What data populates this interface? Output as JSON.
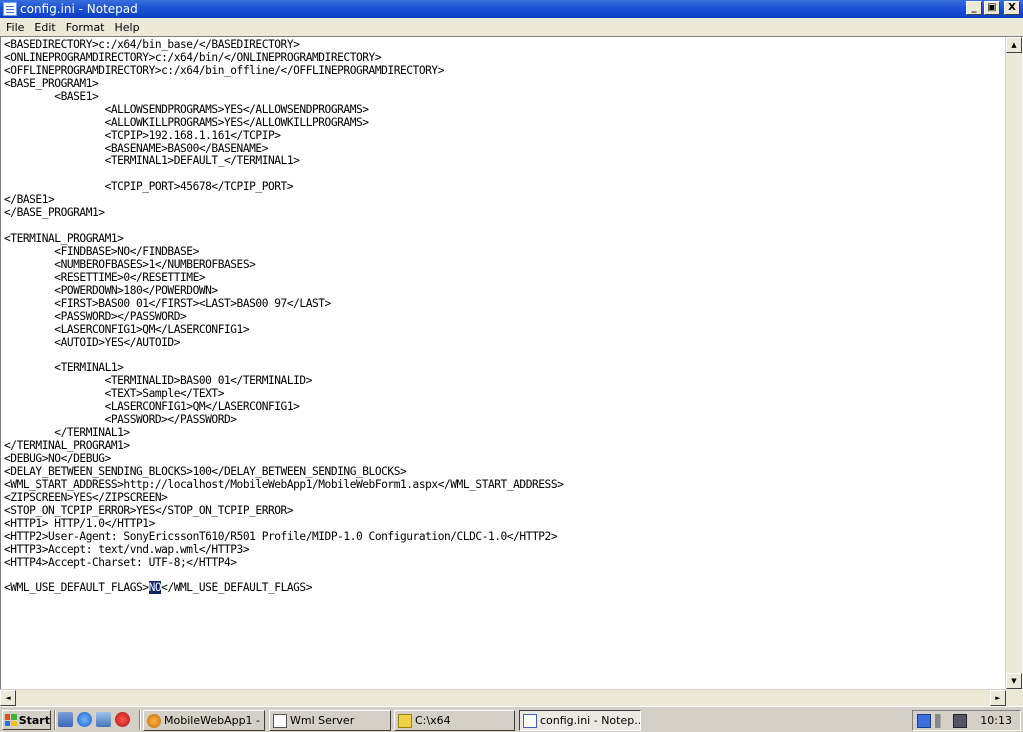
{
  "window": {
    "title": "config.ini - Notepad",
    "controls": {
      "minimize": "_",
      "maximize": "▣",
      "close": "X"
    }
  },
  "menu": [
    "File",
    "Edit",
    "Format",
    "Help"
  ],
  "editor": {
    "lines": [
      "<BASEDIRECTORY>c:/x64/bin_base/</BASEDIRECTORY>",
      "<ONLINEPROGRAMDIRECTORY>c:/x64/bin/</ONLINEPROGRAMDIRECTORY>",
      "<OFFLINEPROGRAMDIRECTORY>c:/x64/bin_offline/</OFFLINEPROGRAMDIRECTORY>",
      "<BASE_PROGRAM1>",
      "        <BASE1>",
      "                <ALLOWSENDPROGRAMS>YES</ALLOWSENDPROGRAMS>",
      "                <ALLOWKILLPROGRAMS>YES</ALLOWKILLPROGRAMS>",
      "                <TCPIP>192.168.1.161</TCPIP>",
      "                <BASENAME>BAS00</BASENAME>",
      "                <TERMINAL1>DEFAULT_</TERMINAL1>",
      "",
      "                <TCPIP_PORT>45678</TCPIP_PORT>",
      "</BASE1>",
      "</BASE_PROGRAM1>",
      "",
      "<TERMINAL_PROGRAM1>",
      "        <FINDBASE>NO</FINDBASE>",
      "        <NUMBEROFBASES>1</NUMBEROFBASES>",
      "        <RESETTIME>0</RESETTIME>",
      "        <POWERDOWN>180</POWERDOWN>",
      "        <FIRST>BAS00 01</FIRST><LAST>BAS00 97</LAST>",
      "        <PASSWORD></PASSWORD>",
      "        <LASERCONFIG1>QM</LASERCONFIG1>",
      "        <AUTOID>YES</AUTOID>",
      "",
      "        <TERMINAL1>",
      "                <TERMINALID>BAS00 01</TERMINALID>",
      "                <TEXT>Sample</TEXT>",
      "                <LASERCONFIG1>QM</LASERCONFIG1>",
      "                <PASSWORD></PASSWORD>",
      "        </TERMINAL1>",
      "</TERMINAL_PROGRAM1>",
      "<DEBUG>NO</DEBUG>",
      "<DELAY_BETWEEN_SENDING_BLOCKS>100</DELAY_BETWEEN_SENDING_BLOCKS>",
      "<WML_START_ADDRESS>http://localhost/MobileWebApp1/MobileWebForm1.aspx</WML_START_ADDRESS>",
      "<ZIPSCREEN>YES</ZIPSCREEN>",
      "<STOP_ON_TCPIP_ERROR>YES</STOP_ON_TCPIP_ERROR>",
      "<HTTP1> HTTP/1.0</HTTP1>",
      "<HTTP2>User-Agent: SonyEricssonT610/R501 Profile/MIDP-1.0 Configuration/CLDC-1.0</HTTP2>",
      "<HTTP3>Accept: text/vnd.wap.wml</HTTP3>",
      "<HTTP4>Accept-Charset: UTF-8;</HTTP4>",
      ""
    ],
    "last_line": {
      "before": "<WML_USE_DEFAULT_FLAGS>",
      "selected": "NO",
      "after": "</WML_USE_DEFAULT_FLAGS>"
    }
  },
  "scrollbars": {
    "up": "▲",
    "down": "▼",
    "left": "◄",
    "right": "►"
  },
  "taskbar": {
    "start_label": "Start",
    "tasks": [
      {
        "label": "MobileWebApp1 - ...",
        "active": false,
        "icon": "ie-icon"
      },
      {
        "label": "Wml Server",
        "active": false,
        "icon": "app-window-icon"
      },
      {
        "label": "C:\\x64",
        "active": false,
        "icon": "folder-icon"
      },
      {
        "label": "config.ini - Notep...",
        "active": true,
        "icon": "notepad-icon"
      }
    ],
    "clock": "10:13",
    "colors": {
      "title_bar": "#0a3fc4",
      "selection": "#0a246a"
    }
  }
}
